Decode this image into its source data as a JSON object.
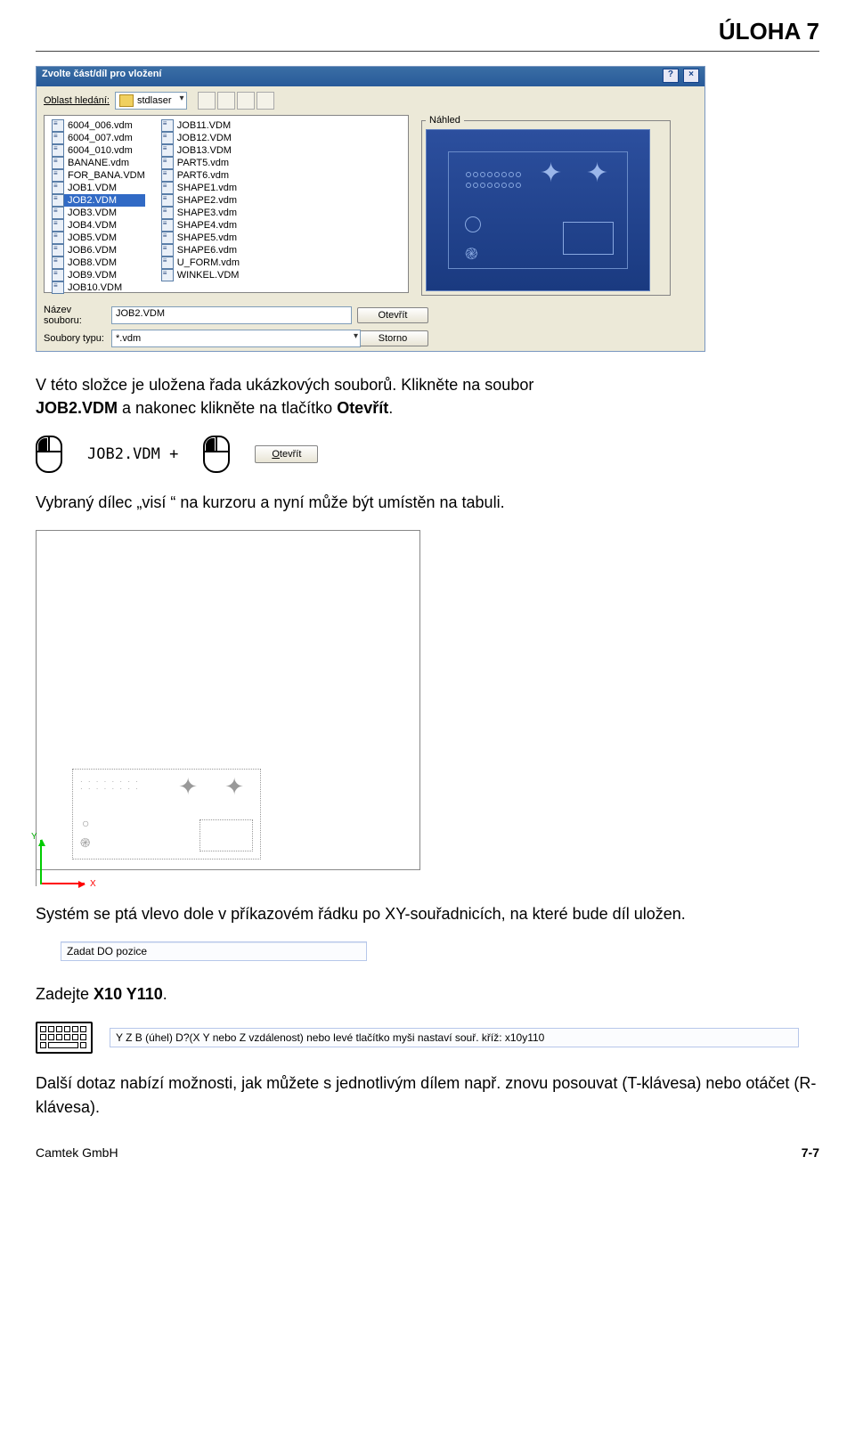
{
  "header": {
    "title": "ÚLOHA 7"
  },
  "dialog": {
    "title": "Zvolte část/díl pro vložení",
    "lookin_label": "Oblast hledání:",
    "folder_name": "stdlaser",
    "preview_label": "Náhled",
    "filename_label": "Název souboru:",
    "filetype_label": "Soubory typu:",
    "filename_value": "JOB2.VDM",
    "filetype_value": "*.vdm",
    "open_label": "Otevřít",
    "cancel_label": "Storno",
    "files_col1": [
      "6004_006.vdm",
      "6004_007.vdm",
      "6004_010.vdm",
      "BANANE.vdm",
      "FOR_BANA.VDM",
      "JOB1.VDM",
      "JOB2.VDM",
      "JOB3.VDM",
      "JOB4.VDM",
      "JOB5.VDM",
      "JOB6.VDM",
      "JOB8.VDM",
      "JOB9.VDM",
      "JOB10.VDM"
    ],
    "files_col2": [
      "JOB11.VDM",
      "JOB12.VDM",
      "JOB13.VDM",
      "PART5.vdm",
      "PART6.vdm",
      "SHAPE1.vdm",
      "SHAPE2.vdm",
      "SHAPE3.vdm",
      "SHAPE4.vdm",
      "SHAPE5.vdm",
      "SHAPE6.vdm",
      "U_FORM.vdm",
      "WINKEL.VDM"
    ],
    "selected_file": "JOB2.VDM"
  },
  "body": {
    "para1a": "V této složce je uložena řada ukázkových souborů. Klikněte na soubor",
    "para1b_strong": " JOB2.VDM",
    "para1c": "  a nakonec klikněte na tlačítko ",
    "para1d_strong": "Otevřít",
    "para1e": ".",
    "code": "JOB2.VDM   +",
    "btn_open": "Otevřít",
    "para2": "Vybraný dílec „visí “ na kurzoru a nyní může být umístěn na tabuli.",
    "axis_x": "X",
    "axis_y": "Y",
    "para3": "Systém se ptá vlevo dole v příkazovém řádku po XY-souřadnicích, na které bude díl uložen.",
    "input1": "Zadat DO pozice",
    "para4a": "Zadejte ",
    "para4b_strong": "X10 Y110",
    "para4c": ".",
    "long_input": "Y Z B (úhel) D?(X Y nebo Z vzdálenost)  nebo levé tlačítko myši nastaví souř. kříž: x10y110",
    "para5": "Další dotaz nabízí možnosti, jak můžete s jednotlivým dílem např. znovu posouvat (T-klávesa) nebo otáčet (R-klávesa)."
  },
  "footer": {
    "left": "Camtek GmbH",
    "right": "7-7"
  }
}
